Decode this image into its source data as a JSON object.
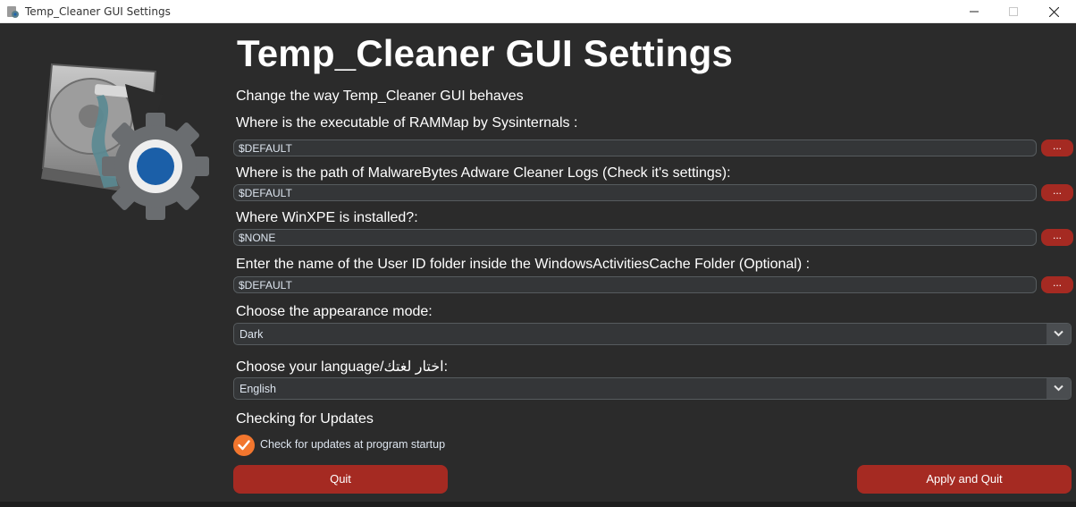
{
  "window": {
    "title": "Temp_Cleaner GUI Settings"
  },
  "heading": "Temp_Cleaner GUI Settings",
  "subheading": "Change the way Temp_Cleaner GUI behaves",
  "fields": [
    {
      "label": "Where is the executable of RAMMap by Sysinternals :",
      "value": "$DEFAULT",
      "browse_label": "..."
    },
    {
      "label": "Where is the path of MalwareBytes Adware Cleaner Logs (Check it's settings):",
      "value": "$DEFAULT",
      "browse_label": "..."
    },
    {
      "label": "Where WinXPE is installed?:",
      "value": "$NONE",
      "browse_label": "..."
    },
    {
      "label": "Enter the name of the User ID folder inside the WindowsActivitiesCache Folder (Optional) :",
      "value": "$DEFAULT",
      "browse_label": "..."
    }
  ],
  "appearance": {
    "label": "Choose the appearance mode:",
    "selected": "Dark"
  },
  "language": {
    "label": "Choose your language/اختار لغتك:",
    "selected": "English"
  },
  "updates": {
    "heading": "Checking for Updates",
    "checkbox_label": "Check for updates at program startup",
    "checked": true
  },
  "buttons": {
    "quit": "Quit",
    "apply": "Apply and Quit"
  },
  "colors": {
    "accent": "#a52a22",
    "checkbox": "#f2762e",
    "background": "#2b2b2b"
  },
  "icons": {
    "logo": "hard-drive-gear-icon"
  }
}
